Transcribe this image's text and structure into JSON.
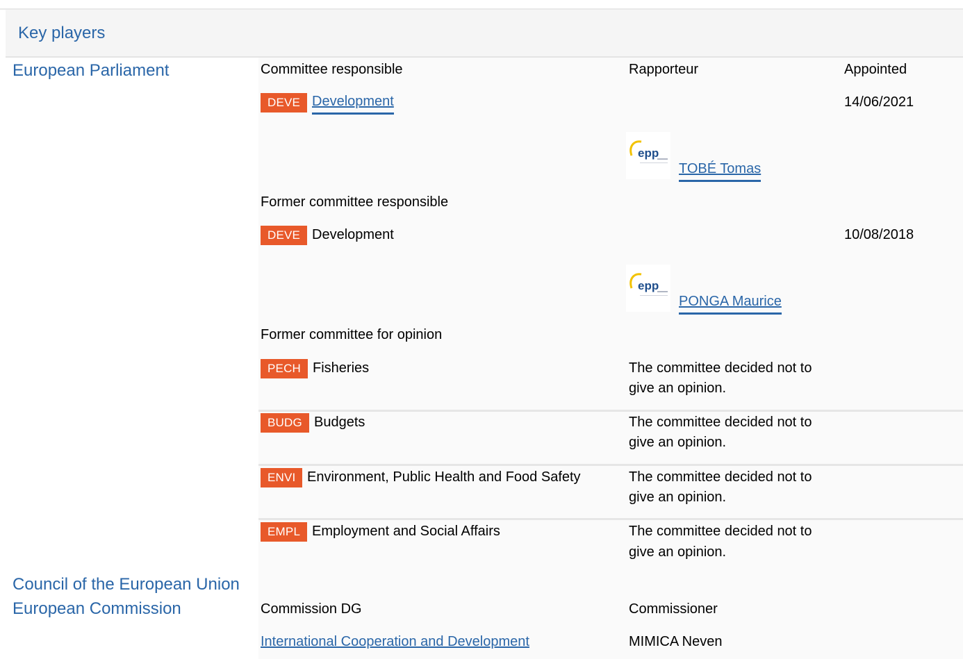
{
  "panel": {
    "title": "Key players"
  },
  "institutions": {
    "parliament": "European Parliament",
    "council": "Council of the European Union",
    "commission": "European Commission"
  },
  "headers": {
    "committee_responsible": "Committee responsible",
    "rapporteur": "Rapporteur",
    "appointed": "Appointed",
    "former_committee_responsible": "Former committee responsible",
    "former_committee_opinion": "Former committee for opinion",
    "commission_dg": "Commission DG",
    "commissioner": "Commissioner"
  },
  "responsible": {
    "code": "DEVE",
    "name": "Development",
    "appointed": "14/06/2021",
    "rapporteur": "TOBÉ Tomas",
    "logo_text": "epp"
  },
  "former_responsible": {
    "code": "DEVE",
    "name": "Development",
    "appointed": "10/08/2018",
    "rapporteur": "PONGA Maurice",
    "logo_text": "epp"
  },
  "opinion_committees": [
    {
      "code": "PECH",
      "name": "Fisheries",
      "note_line1": "The committee decided not to",
      "note_line2": "give an opinion."
    },
    {
      "code": "BUDG",
      "name": "Budgets",
      "note_line1": "The committee decided not to",
      "note_line2": "give an opinion."
    },
    {
      "code": "ENVI",
      "name": "Environment, Public Health and Food Safety",
      "note_line1": "The committee decided not to",
      "note_line2": "give an opinion."
    },
    {
      "code": "EMPL",
      "name": "Employment and Social Affairs",
      "note_line1": "The committee decided not to",
      "note_line2": "give an opinion."
    }
  ],
  "commission": {
    "dg": "International Cooperation and Development",
    "commissioner": "MIMICA Neven"
  },
  "colors": {
    "accent": "#2a66a8",
    "tag": "#e8592a",
    "logo_yellow": "#f2c200",
    "logo_blue": "#1f4e8c"
  }
}
